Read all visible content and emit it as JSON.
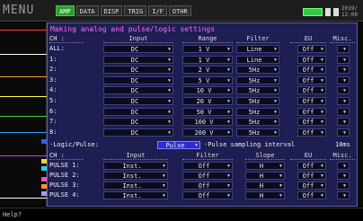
{
  "menu_title": "MENU",
  "tabs": [
    {
      "label": "AMP",
      "active": true
    },
    {
      "label": "DATA",
      "active": false
    },
    {
      "label": "DISP",
      "active": false
    },
    {
      "label": "TRIG",
      "active": false
    },
    {
      "label": "I/F",
      "active": false
    },
    {
      "label": "OTHR",
      "active": false
    }
  ],
  "status": {
    "clock_line1": "2019/",
    "clock_line2": "12:00",
    "battery_color": "#2ecc40"
  },
  "dialog_title": "Making analog and pulse/logic settings",
  "analog_headers": {
    "ch": "CH :",
    "input": "Input",
    "range": "Range",
    "filter": "Filter",
    "eu": "EU",
    "misc": "Misc."
  },
  "analog_rows": [
    {
      "ch": "ALL:",
      "input": "DC",
      "range": "1 V",
      "filter": "Line",
      "eu": "Off"
    },
    {
      "ch": "1:",
      "input": "DC",
      "range": "1 V",
      "filter": "Line",
      "eu": "Off"
    },
    {
      "ch": "2:",
      "input": "DC",
      "range": "2 V",
      "filter": "5Hz",
      "eu": "Off"
    },
    {
      "ch": "3:",
      "input": "DC",
      "range": "5 V",
      "filter": "5Hz",
      "eu": "Off"
    },
    {
      "ch": "4:",
      "input": "DC",
      "range": "10 V",
      "filter": "5Hz",
      "eu": "Off"
    },
    {
      "ch": "5:",
      "input": "DC",
      "range": "20 V",
      "filter": "5Hz",
      "eu": "Off"
    },
    {
      "ch": "6:",
      "input": "DC",
      "range": "50 V",
      "filter": "5Hz",
      "eu": "Off"
    },
    {
      "ch": "7:",
      "input": "DC",
      "range": "100 V",
      "filter": "5Hz",
      "eu": "Off"
    },
    {
      "ch": "8:",
      "input": "DC",
      "range": "200 V",
      "filter": "5Hz",
      "eu": "Off"
    }
  ],
  "logic_pulse": {
    "label": "·Logic/Pulse:",
    "value": "Pulse",
    "sampling_label": "·Pulse sampling interval",
    "sampling_value": "10ms"
  },
  "pulse_headers": {
    "ch": "CH :",
    "input": "Input",
    "filter": "Filter",
    "slope": "Slope",
    "eu": "EU",
    "misc": "Misc."
  },
  "pulse_rows": [
    {
      "ch": "PULSE 1:",
      "input": "Inst.",
      "filter": "Off",
      "slope": "H",
      "eu": "Off"
    },
    {
      "ch": "PULSE 2:",
      "input": "Inst.",
      "filter": "Off",
      "slope": "H",
      "eu": "Off"
    },
    {
      "ch": "PULSE 3:",
      "input": "Inst.",
      "filter": "Off",
      "slope": "H",
      "eu": "Off"
    },
    {
      "ch": "PULSE 4:",
      "input": "Inst.",
      "filter": "Off",
      "slope": "H",
      "eu": "Off"
    }
  ],
  "help_text": "Help?",
  "colors": {
    "accent": "#2f9a2f",
    "dialog_bg": "#1e1e52",
    "title_magenta": "#ff6aff",
    "select": "#2b2bd0"
  }
}
